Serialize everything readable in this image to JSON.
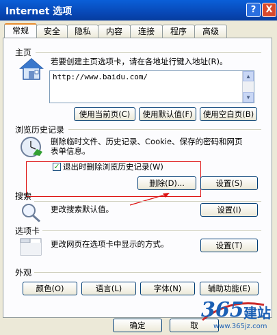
{
  "window": {
    "title": "Internet 选项",
    "help": "?",
    "close": "X"
  },
  "tabs": [
    "常规",
    "安全",
    "隐私",
    "内容",
    "连接",
    "程序",
    "高级"
  ],
  "home": {
    "label": "主页",
    "description": "若要创建主页选项卡，请在各地址行键入地址(R)。",
    "url": "http://www.baidu.com/",
    "use_current": "使用当前页(C)",
    "use_default": "使用默认值(F)",
    "use_blank": "使用空白页(B)"
  },
  "history": {
    "label": "浏览历史记录",
    "description_line1": "删除临时文件、历史记录、Cookie、保存的密码和网页",
    "description_line2": "表单信息。",
    "checkbox_label": "退出时删除浏览历史记录(W)",
    "checkbox_checked": true,
    "delete_button": "删除(D)...",
    "settings_button": "设置(S)"
  },
  "search": {
    "label": "搜索",
    "description": "更改搜索默认值。",
    "settings_button": "设置(I)"
  },
  "tabs_section": {
    "label": "选项卡",
    "description": "更改网页在选项卡中显示的方式。",
    "settings_button": "设置(T)"
  },
  "appearance": {
    "label": "外观",
    "colors": "颜色(O)",
    "languages": "语言(L)",
    "fonts": "字体(N)",
    "accessibility": "辅助功能(E)"
  },
  "footer": {
    "ok": "确定",
    "cancel": "取"
  },
  "watermark": {
    "brand": "365",
    "suffix": "建站",
    "url": "www.365jz.com"
  },
  "colors": {
    "titlebar": "#0849b8",
    "annotation": "#dd1111"
  }
}
